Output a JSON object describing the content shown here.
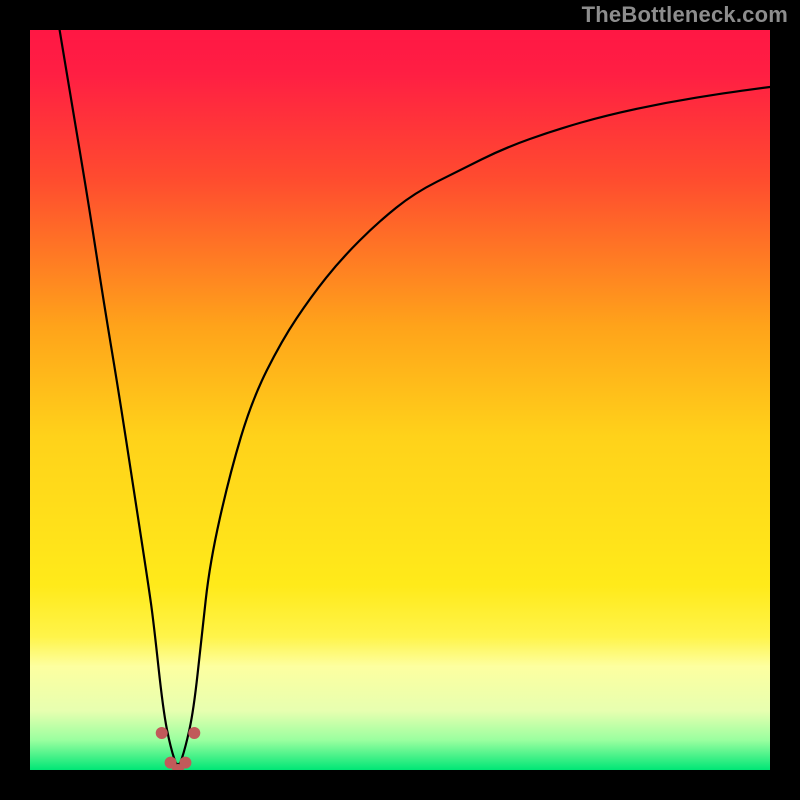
{
  "watermark": "TheBottleneck.com",
  "chart_data": {
    "type": "line",
    "title": "",
    "xlabel": "",
    "ylabel": "",
    "xlim": [
      0,
      1
    ],
    "ylim": [
      0,
      100
    ],
    "background_gradient": {
      "stops": [
        {
          "offset": 0.0,
          "color": "#ff1744"
        },
        {
          "offset": 0.06,
          "color": "#ff1f43"
        },
        {
          "offset": 0.2,
          "color": "#ff4b2f"
        },
        {
          "offset": 0.4,
          "color": "#ffa31a"
        },
        {
          "offset": 0.55,
          "color": "#ffd21a"
        },
        {
          "offset": 0.75,
          "color": "#ffea1a"
        },
        {
          "offset": 0.82,
          "color": "#fff44a"
        },
        {
          "offset": 0.86,
          "color": "#fdffa0"
        },
        {
          "offset": 0.92,
          "color": "#e7ffb0"
        },
        {
          "offset": 0.96,
          "color": "#99ff9f"
        },
        {
          "offset": 1.0,
          "color": "#00e676"
        }
      ]
    },
    "series": [
      {
        "name": "bottleneck-curve",
        "color": "#000000",
        "width": 2.2,
        "x": [
          0.04,
          0.06,
          0.08,
          0.1,
          0.12,
          0.14,
          0.16,
          0.167,
          0.18,
          0.19,
          0.2,
          0.21,
          0.221,
          0.232,
          0.243,
          0.27,
          0.3,
          0.34,
          0.38,
          0.42,
          0.47,
          0.52,
          0.58,
          0.64,
          0.71,
          0.78,
          0.86,
          0.94,
          1.0
        ],
        "y": [
          100,
          88,
          76,
          63,
          51,
          38,
          25,
          20,
          8,
          3,
          0,
          3,
          8,
          18,
          28,
          40,
          50,
          58,
          64,
          69,
          74,
          78,
          81,
          84,
          86.5,
          88.5,
          90.2,
          91.5,
          92.3
        ]
      }
    ],
    "markers": {
      "name": "valley-markers",
      "color": "#c15a5a",
      "radius": 6,
      "points": [
        {
          "x": 0.178,
          "y": 5.0
        },
        {
          "x": 0.19,
          "y": 1.0
        },
        {
          "x": 0.2,
          "y": 0.0
        },
        {
          "x": 0.21,
          "y": 1.0
        },
        {
          "x": 0.222,
          "y": 5.0
        }
      ]
    }
  }
}
